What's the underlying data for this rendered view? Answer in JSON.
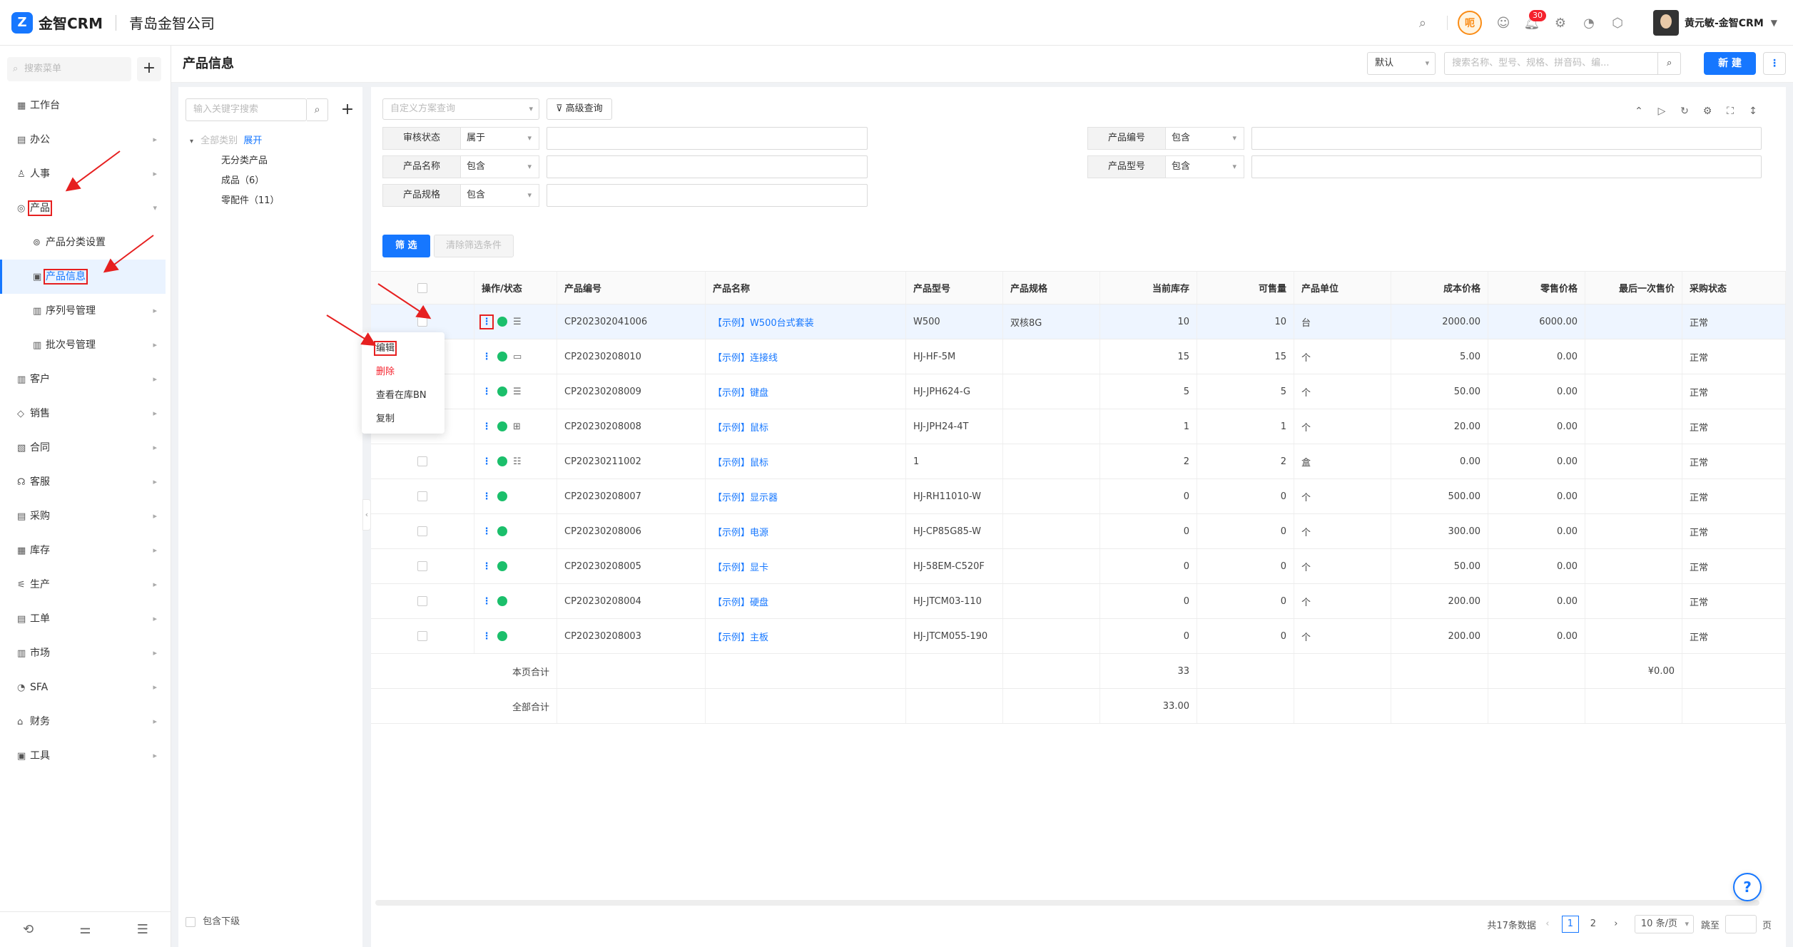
{
  "app": {
    "logo_text": "金智CRM",
    "company": "青岛金智公司"
  },
  "topbar": {
    "notif_count": "30",
    "user_name": "黄元敏-金智CRM",
    "orange_icon_label": "呃"
  },
  "sidebar": {
    "search_placeholder": "搜索菜单",
    "items": [
      {
        "label": "工作台",
        "icon": "dashboard-icon",
        "arrow": false
      },
      {
        "label": "办公",
        "icon": "office-icon",
        "arrow": true
      },
      {
        "label": "人事",
        "icon": "people-icon",
        "arrow": true
      },
      {
        "label": "产品",
        "icon": "product-icon",
        "arrow": true,
        "expanded": true
      },
      {
        "label": "产品分类设置",
        "icon": "category-icon",
        "sub": true
      },
      {
        "label": "产品信息",
        "icon": "product-info-icon",
        "sub": true,
        "active": true
      },
      {
        "label": "序列号管理",
        "icon": "serial-icon",
        "sub": true,
        "arrow": true
      },
      {
        "label": "批次号管理",
        "icon": "batch-icon",
        "sub": true,
        "arrow": true
      },
      {
        "label": "客户",
        "icon": "customer-icon",
        "arrow": true
      },
      {
        "label": "销售",
        "icon": "sales-icon",
        "arrow": true
      },
      {
        "label": "合同",
        "icon": "contract-icon",
        "arrow": true
      },
      {
        "label": "客服",
        "icon": "service-icon",
        "arrow": true
      },
      {
        "label": "采购",
        "icon": "purchase-icon",
        "arrow": true
      },
      {
        "label": "库存",
        "icon": "inventory-icon",
        "arrow": true
      },
      {
        "label": "生产",
        "icon": "production-icon",
        "arrow": true
      },
      {
        "label": "工单",
        "icon": "workorder-icon",
        "arrow": true
      },
      {
        "label": "市场",
        "icon": "market-icon",
        "arrow": true
      },
      {
        "label": "SFA",
        "icon": "sfa-icon",
        "arrow": true
      },
      {
        "label": "财务",
        "icon": "finance-icon",
        "arrow": true
      },
      {
        "label": "工具",
        "icon": "tools-icon",
        "arrow": true
      }
    ]
  },
  "header": {
    "title": "产品信息",
    "view_select": "默认",
    "search_placeholder": "搜索名称、型号、规格、拼音码、编...",
    "new_button": "新 建"
  },
  "tree": {
    "search_placeholder": "输入关键字搜索",
    "root_label": "全部类别",
    "expand_label": "展开",
    "nodes": [
      "无分类产品",
      "成品（6）",
      "零配件（11）"
    ],
    "include_sub": "包含下级"
  },
  "filter": {
    "custom_placeholder": "自定义方案查询",
    "advanced": "高级查询",
    "rows": [
      {
        "label": "审核状态",
        "op": "属于"
      },
      {
        "label": "产品编号",
        "op": "包含"
      },
      {
        "label": "产品名称",
        "op": "包含"
      },
      {
        "label": "产品型号",
        "op": "包含"
      },
      {
        "label": "产品规格",
        "op": "包含"
      }
    ],
    "submit": "筛 选",
    "clear": "清除筛选条件"
  },
  "table": {
    "columns": [
      "操作/状态",
      "产品编号",
      "产品名称",
      "产品型号",
      "产品规格",
      "当前库存",
      "可售量",
      "产品单位",
      "成本价格",
      "零售价格",
      "最后一次售价",
      "采购状态"
    ],
    "rows": [
      [
        "CP202302041006",
        "【示例】W500台式套装",
        "W500",
        "双核8G",
        "10",
        "10",
        "台",
        "2000.00",
        "6000.00",
        "",
        "正常"
      ],
      [
        "CP20230208010",
        "【示例】连接线",
        "HJ-HF-5M",
        "",
        "15",
        "15",
        "个",
        "5.00",
        "0.00",
        "",
        "正常"
      ],
      [
        "CP20230208009",
        "【示例】键盘",
        "HJ-JPH624-G",
        "",
        "5",
        "5",
        "个",
        "50.00",
        "0.00",
        "",
        "正常"
      ],
      [
        "CP20230208008",
        "【示例】鼠标",
        "HJ-JPH24-4T",
        "",
        "1",
        "1",
        "个",
        "20.00",
        "0.00",
        "",
        "正常"
      ],
      [
        "CP20230211002",
        "【示例】鼠标",
        "1",
        "",
        "2",
        "2",
        "盒",
        "0.00",
        "0.00",
        "",
        "正常"
      ],
      [
        "CP20230208007",
        "【示例】显示器",
        "HJ-RH11010-W",
        "",
        "0",
        "0",
        "个",
        "500.00",
        "0.00",
        "",
        "正常"
      ],
      [
        "CP20230208006",
        "【示例】电源",
        "HJ-CP85G85-W",
        "",
        "0",
        "0",
        "个",
        "300.00",
        "0.00",
        "",
        "正常"
      ],
      [
        "CP20230208005",
        "【示例】显卡",
        "HJ-58EM-C520F",
        "",
        "0",
        "0",
        "个",
        "50.00",
        "0.00",
        "",
        "正常"
      ],
      [
        "CP20230208004",
        "【示例】硬盘",
        "HJ-JTCM03-110",
        "",
        "0",
        "0",
        "个",
        "200.00",
        "0.00",
        "",
        "正常"
      ],
      [
        "CP20230208003",
        "【示例】主板",
        "HJ-JTCM055-190",
        "",
        "0",
        "0",
        "个",
        "200.00",
        "0.00",
        "",
        "正常"
      ]
    ],
    "page_total_label": "本页合计",
    "page_total_stock": "33",
    "page_total_last_price": "¥0.00",
    "all_total_label": "全部合计",
    "all_total_stock": "33.00"
  },
  "context_menu": {
    "items": [
      "编辑",
      "删除",
      "查看在库BN",
      "复制"
    ]
  },
  "pagination": {
    "total": "共17条数据",
    "pages": [
      "1",
      "2"
    ],
    "current": "1",
    "page_size": "10 条/页",
    "goto": "跳至",
    "page_unit": "页"
  }
}
